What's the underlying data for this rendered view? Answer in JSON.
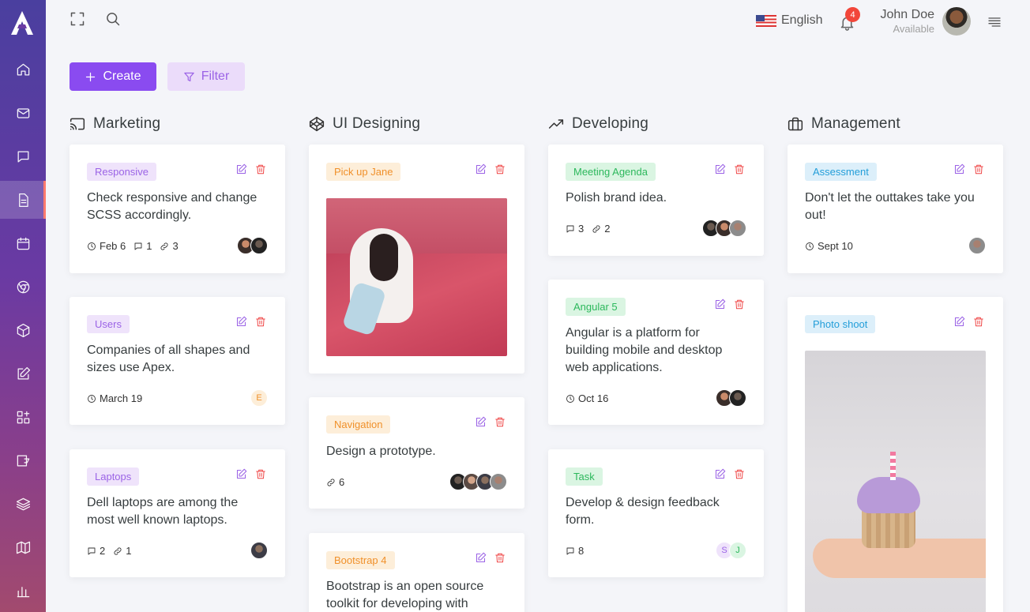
{
  "header": {
    "language": "English",
    "notifications_count": "4",
    "user_name": "John Doe",
    "user_status": "Available"
  },
  "toolbar": {
    "create_label": "Create",
    "filter_label": "Filter"
  },
  "columns": [
    {
      "title": "Marketing",
      "icon": "cast-icon",
      "cards": [
        {
          "tag": "Responsive",
          "text": "Check responsive and change SCSS accordingly.",
          "date": "Feb 6",
          "comments": "1",
          "links": "3"
        },
        {
          "tag": "Users",
          "text": "Companies of all shapes and sizes use Apex.",
          "date": "March 19",
          "avatar_letter": "E"
        },
        {
          "tag": "Laptops",
          "text": "Dell laptops are among the most well known laptops.",
          "comments": "2",
          "links": "1"
        }
      ]
    },
    {
      "title": "UI Designing",
      "icon": "codepen-icon",
      "cards": [
        {
          "tag": "Pick up Jane"
        },
        {
          "tag": "Navigation",
          "text": "Design a prototype.",
          "links": "6"
        },
        {
          "tag": "Bootstrap 4",
          "text": "Bootstrap is an open source toolkit for developing with"
        }
      ]
    },
    {
      "title": "Developing",
      "icon": "trending-up-icon",
      "cards": [
        {
          "tag": "Meeting Agenda",
          "text": "Polish brand idea.",
          "comments": "3",
          "links": "2"
        },
        {
          "tag": "Angular 5",
          "text": "Angular is a platform for building mobile and desktop web applications.",
          "date": "Oct 16"
        },
        {
          "tag": "Task",
          "text": "Develop & design feedback form.",
          "comments": "8",
          "avatar_letters": [
            "S",
            "J"
          ]
        }
      ]
    },
    {
      "title": "Management",
      "icon": "briefcase-icon",
      "cards": [
        {
          "tag": "Assessment",
          "text": "Don't let the outtakes take you out!",
          "date": "Sept 10"
        },
        {
          "tag": "Photo shoot"
        }
      ]
    }
  ],
  "colors": {
    "accent": "#8a4bf0",
    "danger": "#ef4444",
    "sidebar_top": "#4a3f9f",
    "sidebar_bottom": "#a24a6e"
  }
}
